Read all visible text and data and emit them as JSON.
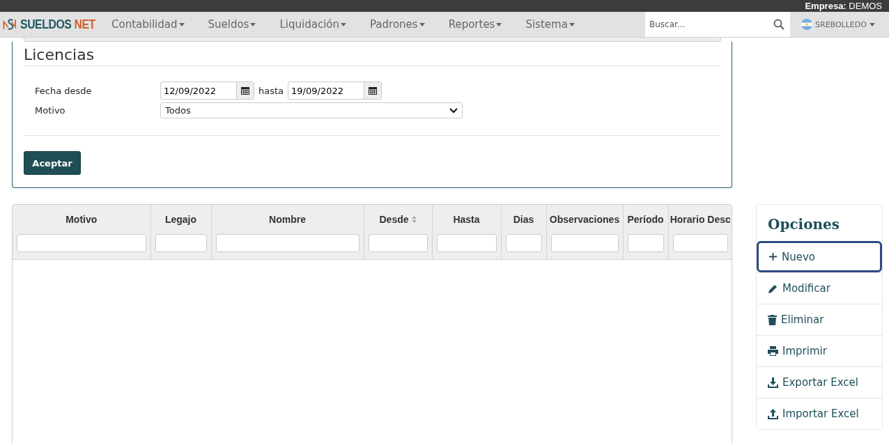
{
  "topbar": {
    "company_label": "Empresa:",
    "company": "DEMOS"
  },
  "navbar": {
    "brand": {
      "name": "SUELDOS",
      "suffix": "NET"
    },
    "menus": [
      {
        "label": "Contabilidad"
      },
      {
        "label": "Sueldos"
      },
      {
        "label": "Liquidación"
      },
      {
        "label": "Padrones"
      },
      {
        "label": "Reportes"
      },
      {
        "label": "Sistema"
      }
    ],
    "search": {
      "placeholder": "Buscar..."
    },
    "user": "SREBOLLEDO"
  },
  "form": {
    "title": "Licencias",
    "date_label": "Fecha desde",
    "date_from": "12/09/2022",
    "until_label": "hasta",
    "date_to": "19/09/2022",
    "reason_label": "Motivo",
    "reason": "Todos",
    "submit": "Aceptar"
  },
  "table": {
    "columns": [
      {
        "label": "Motivo",
        "sortable": false
      },
      {
        "label": "Legajo",
        "sortable": false
      },
      {
        "label": "Nombre",
        "sortable": false
      },
      {
        "label": "Desde",
        "sortable": true
      },
      {
        "label": "Hasta",
        "sortable": false
      },
      {
        "label": "Dias",
        "sortable": false
      },
      {
        "label": "Observaciones",
        "sortable": false
      },
      {
        "label": "Período",
        "sortable": false
      },
      {
        "label": "Horario Desc",
        "sortable": false
      }
    ]
  },
  "options": {
    "title": "Opciones",
    "items": [
      {
        "kind": "plus",
        "label": "Nuevo",
        "selected": true
      },
      {
        "kind": "pencil",
        "label": "Modificar",
        "selected": false
      },
      {
        "kind": "trash",
        "label": "Eliminar",
        "selected": false
      },
      {
        "kind": "printer",
        "label": "Imprimir",
        "selected": false
      },
      {
        "kind": "download",
        "label": "Exportar Excel",
        "selected": false
      },
      {
        "kind": "upload",
        "label": "Importar Excel",
        "selected": false
      }
    ]
  }
}
